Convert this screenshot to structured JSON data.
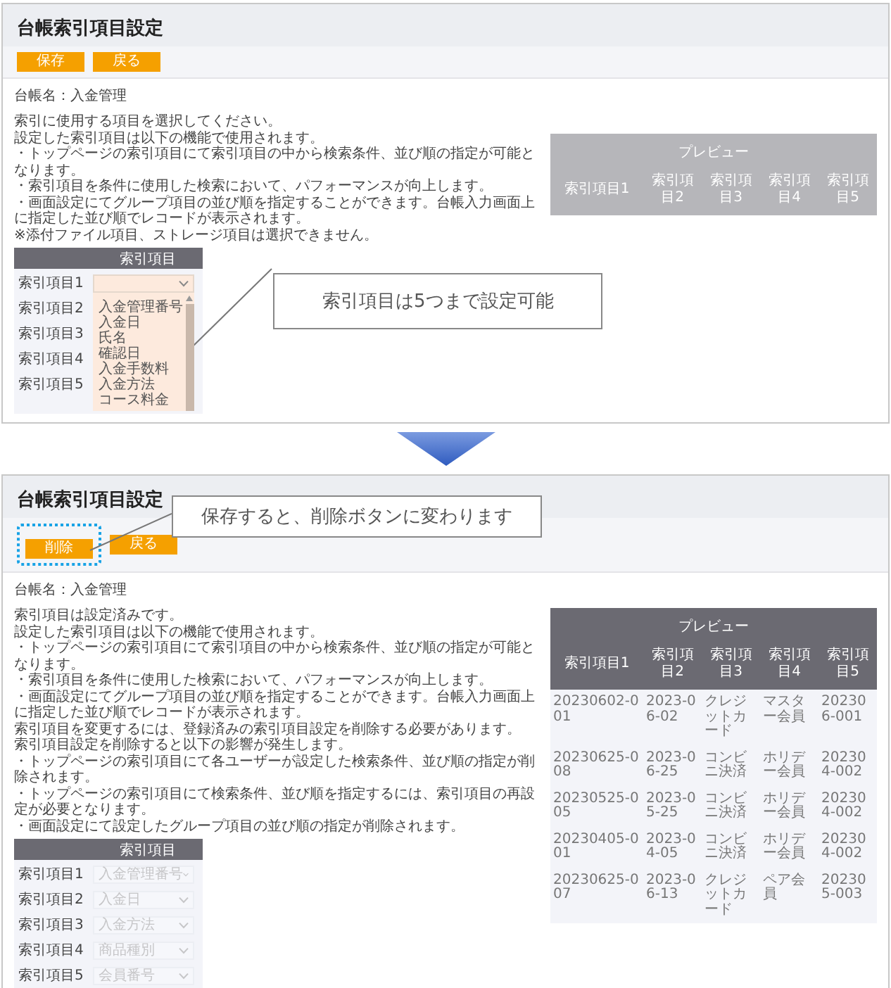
{
  "screens": [
    {
      "title": "台帳索引項目設定",
      "buttons": [
        {
          "label": "保存",
          "highlighted": false
        },
        {
          "label": "戻る",
          "highlighted": false
        }
      ],
      "ledger_name": "台帳名：入金管理",
      "description": [
        "索引に使用する項目を選択してください。",
        "設定した索引項目は以下の機能で使用されます。",
        "・トップページの索引項目にて索引項目の中から検索条件、並び順の指定が可能となります。",
        "・索引項目を条件に使用した検索において、パフォーマンスが向上します。",
        "・画面設定にてグループ項目の並び順を指定することができます。台帳入力画面上に指定した並び順でレコードが表示されます。",
        "※添付ファイル項目、ストレージ項目は選択できません。"
      ],
      "preview": {
        "title": "プレビュー",
        "active": false,
        "columns": [
          "索引項目1",
          "索引項目2",
          "索引項目3",
          "索引項目4",
          "索引項目5"
        ]
      },
      "index_table": {
        "header": "索引項目",
        "disabled": false,
        "rows": [
          {
            "label": "索引項目1",
            "expanded": true,
            "options": [
              "入金管理番号",
              "入金日",
              "氏名",
              "確認日",
              "入金手数料",
              "入金方法",
              "コース料金"
            ]
          },
          {
            "label": "索引項目2"
          },
          {
            "label": "索引項目3"
          },
          {
            "label": "索引項目4"
          },
          {
            "label": "索引項目5"
          }
        ]
      },
      "callout": "索引項目は5つまで設定可能"
    },
    {
      "title": "台帳索引項目設定",
      "buttons": [
        {
          "label": "削除",
          "highlighted": true
        },
        {
          "label": "戻る",
          "highlighted": false
        }
      ],
      "ledger_name": "台帳名：入金管理",
      "description": [
        "索引項目は設定済みです。",
        "設定した索引項目は以下の機能で使用されます。",
        "・トップページの索引項目にて索引項目の中から検索条件、並び順の指定が可能となります。",
        "・索引項目を条件に使用した検索において、パフォーマンスが向上します。",
        "・画面設定にてグループ項目の並び順を指定することができます。台帳入力画面上に指定した並び順でレコードが表示されます。",
        "索引項目を変更するには、登録済みの索引項目設定を削除する必要があります。",
        "索引項目設定を削除すると以下の影響が発生します。",
        "・トップページの索引項目にて各ユーザーが設定した検索条件、並び順の指定が削除されます。",
        "・トップページの索引項目にて検索条件、並び順を指定するには、索引項目の再設定が必要となります。",
        "・画面設定にて設定したグループ項目の並び順の指定が削除されます。"
      ],
      "preview": {
        "title": "プレビュー",
        "active": true,
        "columns": [
          "索引項目1",
          "索引項目2",
          "索引項目3",
          "索引項目4",
          "索引項目5"
        ],
        "rows": [
          [
            "20230602-001",
            "2023-06-02",
            "クレジットカード",
            "マスター会員",
            "202306-001"
          ],
          [
            "20230625-008",
            "2023-06-25",
            "コンビニ決済",
            "ホリデー会員",
            "202304-002"
          ],
          [
            "20230525-005",
            "2023-05-25",
            "コンビニ決済",
            "ホリデー会員",
            "202304-002"
          ],
          [
            "20230405-001",
            "2023-04-05",
            "コンビニ決済",
            "ホリデー会員",
            "202304-002"
          ],
          [
            "20230625-007",
            "2023-06-13",
            "クレジットカード",
            "ペア会員",
            "202305-003"
          ]
        ]
      },
      "index_table": {
        "header": "索引項目",
        "disabled": true,
        "rows": [
          {
            "label": "索引項目1",
            "value": "入金管理番号"
          },
          {
            "label": "索引項目2",
            "value": "入金日"
          },
          {
            "label": "索引項目3",
            "value": "入金方法"
          },
          {
            "label": "索引項目4",
            "value": "商品種別"
          },
          {
            "label": "索引項目5",
            "value": "会員番号"
          }
        ]
      },
      "callout": "保存すると、削除ボタンに変わります"
    }
  ]
}
